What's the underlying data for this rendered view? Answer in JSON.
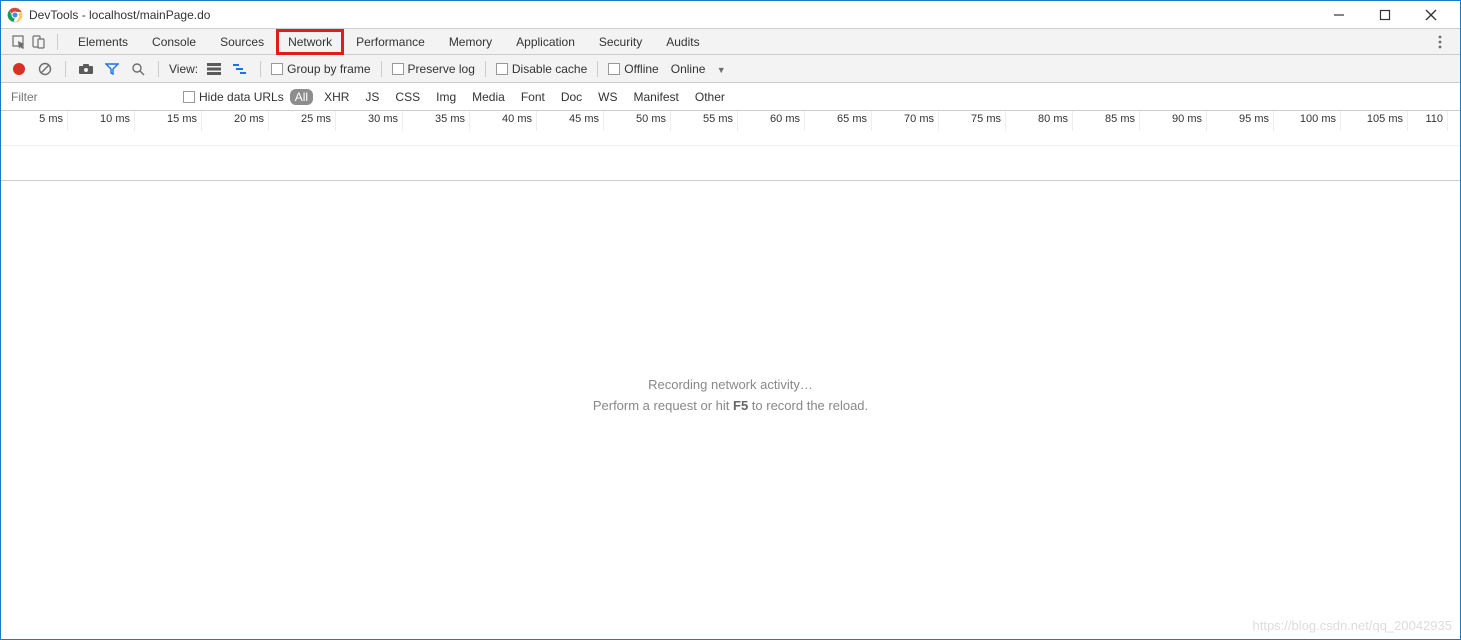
{
  "window": {
    "title": "DevTools - localhost/mainPage.do"
  },
  "tabs": {
    "items": [
      {
        "id": "elements",
        "label": "Elements"
      },
      {
        "id": "console",
        "label": "Console"
      },
      {
        "id": "sources",
        "label": "Sources"
      },
      {
        "id": "network",
        "label": "Network"
      },
      {
        "id": "performance",
        "label": "Performance"
      },
      {
        "id": "memory",
        "label": "Memory"
      },
      {
        "id": "application",
        "label": "Application"
      },
      {
        "id": "security",
        "label": "Security"
      },
      {
        "id": "audits",
        "label": "Audits"
      }
    ],
    "highlighted": "network"
  },
  "toolbar": {
    "view_label": "View:",
    "group_by_frame": "Group by frame",
    "preserve_log": "Preserve log",
    "disable_cache": "Disable cache",
    "offline": "Offline",
    "throttling_selected": "Online"
  },
  "filter": {
    "placeholder": "Filter",
    "hide_data_urls": "Hide data URLs",
    "types": [
      "All",
      "XHR",
      "JS",
      "CSS",
      "Img",
      "Media",
      "Font",
      "Doc",
      "WS",
      "Manifest",
      "Other"
    ],
    "active_type": "All"
  },
  "timeline": {
    "ticks": [
      "5 ms",
      "10 ms",
      "15 ms",
      "20 ms",
      "25 ms",
      "30 ms",
      "35 ms",
      "40 ms",
      "45 ms",
      "50 ms",
      "55 ms",
      "60 ms",
      "65 ms",
      "70 ms",
      "75 ms",
      "80 ms",
      "85 ms",
      "90 ms",
      "95 ms",
      "100 ms",
      "105 ms",
      "110"
    ]
  },
  "empty_state": {
    "line1": "Recording network activity…",
    "line2_before": "Perform a request or hit ",
    "line2_key": "F5",
    "line2_after": " to record the reload."
  },
  "watermark": "https://blog.csdn.net/qq_20042935"
}
